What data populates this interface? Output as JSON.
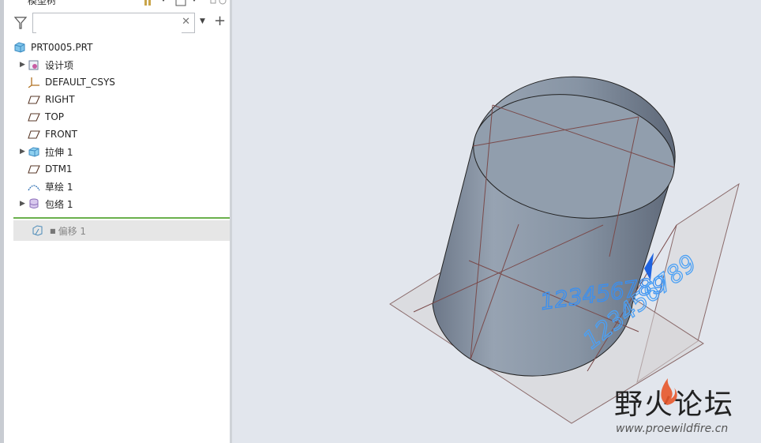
{
  "panel": {
    "title": "模型树"
  },
  "search": {
    "value": "",
    "placeholder": ""
  },
  "tree": {
    "root": "PRT0005.PRT",
    "items": [
      {
        "label": "设计项",
        "expandable": true,
        "icon": "design-items-icon"
      },
      {
        "label": "DEFAULT_CSYS",
        "expandable": false,
        "icon": "csys-icon"
      },
      {
        "label": "RIGHT",
        "expandable": false,
        "icon": "datum-plane-icon"
      },
      {
        "label": "TOP",
        "expandable": false,
        "icon": "datum-plane-icon"
      },
      {
        "label": "FRONT",
        "expandable": false,
        "icon": "datum-plane-icon"
      },
      {
        "label": "拉伸 1",
        "expandable": true,
        "icon": "extrude-icon"
      },
      {
        "label": "DTM1",
        "expandable": false,
        "icon": "datum-plane-icon"
      },
      {
        "label": "草绘 1",
        "expandable": false,
        "icon": "sketch-icon"
      },
      {
        "label": "包络 1",
        "expandable": true,
        "icon": "wrap-icon"
      }
    ],
    "insert_item": {
      "label": "偏移 1",
      "icon": "offset-icon"
    }
  },
  "viewport": {
    "text_front": "123456789",
    "text_back": "123456789"
  },
  "watermark": {
    "name": "野火论坛",
    "url": "www.proewildfire.cn"
  },
  "colors": {
    "accent_green": "#6ab04c",
    "text_blue": "#3a8ff0",
    "cylinder": "#8d99a8"
  }
}
